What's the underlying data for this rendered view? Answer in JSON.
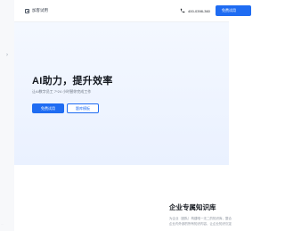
{
  "topbar": {
    "workspace_label": "加客试用",
    "phone": "400-0398-360",
    "cta_label": "免费试用"
  },
  "hero": {
    "title": "AI助力，提升效率",
    "subtitle": "让AI数字员工 7*24 小时替你完成工作",
    "primary_button": "免费试用",
    "secondary_button": "题库模板"
  },
  "section": {
    "title": "企业专属知识库",
    "description": "为企业（团队）构建唯一无二的知识库，整合企业内外部的所有知识内容，让企业知识沉淀"
  }
}
